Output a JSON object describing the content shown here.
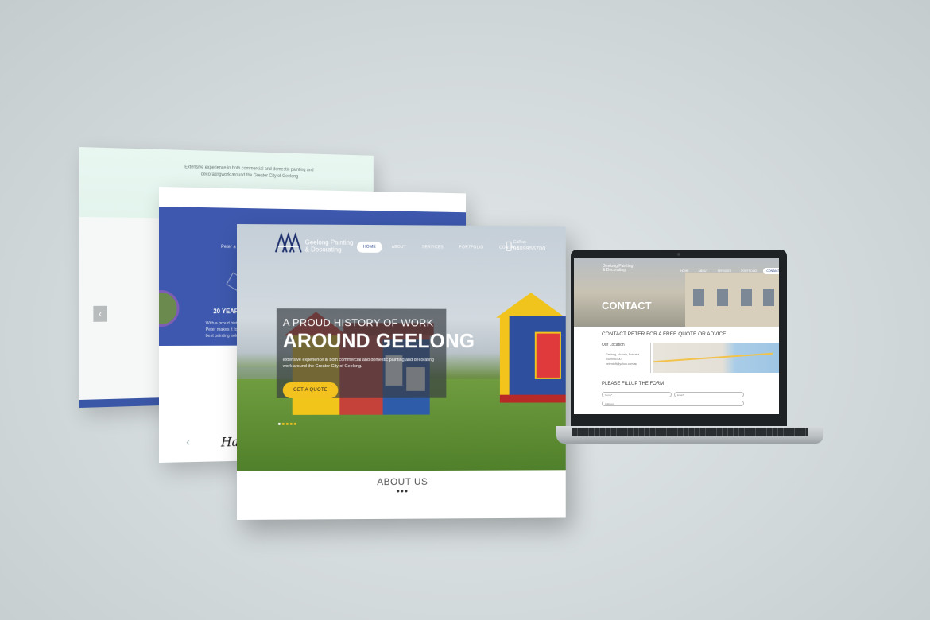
{
  "back_panel_1": {
    "intro": "Extensive experience in both commercial and domestic painting and decoratingwork around the Greater City of Geelong",
    "prev_arrow": "‹"
  },
  "back_panel_2": {
    "peter_text": "Peter a",
    "years_title": "20 YEARS",
    "years_text": "With a proud histo\nPeter makes it for\nbest painting solutio",
    "prev_arrow": "‹",
    "signature": "Ha"
  },
  "main": {
    "logo_text_line1": "Geelong Painting",
    "logo_text_line2": "& Decorating",
    "menu": [
      "HOME",
      "ABOUT",
      "SERVICES",
      "PORTFOLIO",
      "CONTACT"
    ],
    "phone_label": "Call us",
    "phone_number": "0409955700",
    "hero_small": "A PROUD HISTORY OF WORK",
    "hero_big": "AROUND GEELONG",
    "hero_text": "extensive experience in both commercial and domestic painting and decorating work around the Greater City of Geelong.",
    "quote_button": "GET A QUOTE",
    "about_title": "ABOUT US",
    "about_dots": "•••"
  },
  "laptop": {
    "logo_line1": "Geelong Painting",
    "logo_line2": "& Decorating",
    "menu": [
      "HOME",
      "ABOUT",
      "SERVICES",
      "PORTFOLIO",
      "CONTACT"
    ],
    "page_title": "CONTACT",
    "subtitle": "CONTACT PETER FOR A FREE QUOTE OR ADVICE",
    "location_label": "Our Location",
    "address_lines": [
      "Geelong, Victoria, Australia",
      "0409955700",
      "peterdoft@yahoo.com.au"
    ],
    "form_title": "PLEASE FILLUP THE FORM",
    "placeholders": {
      "name": "Name*",
      "email": "Email*",
      "address": "Address"
    }
  },
  "colors": {
    "brand_blue": "#3d58ae",
    "accent_yellow": "#f4c21f",
    "background": "#d3dadc"
  }
}
